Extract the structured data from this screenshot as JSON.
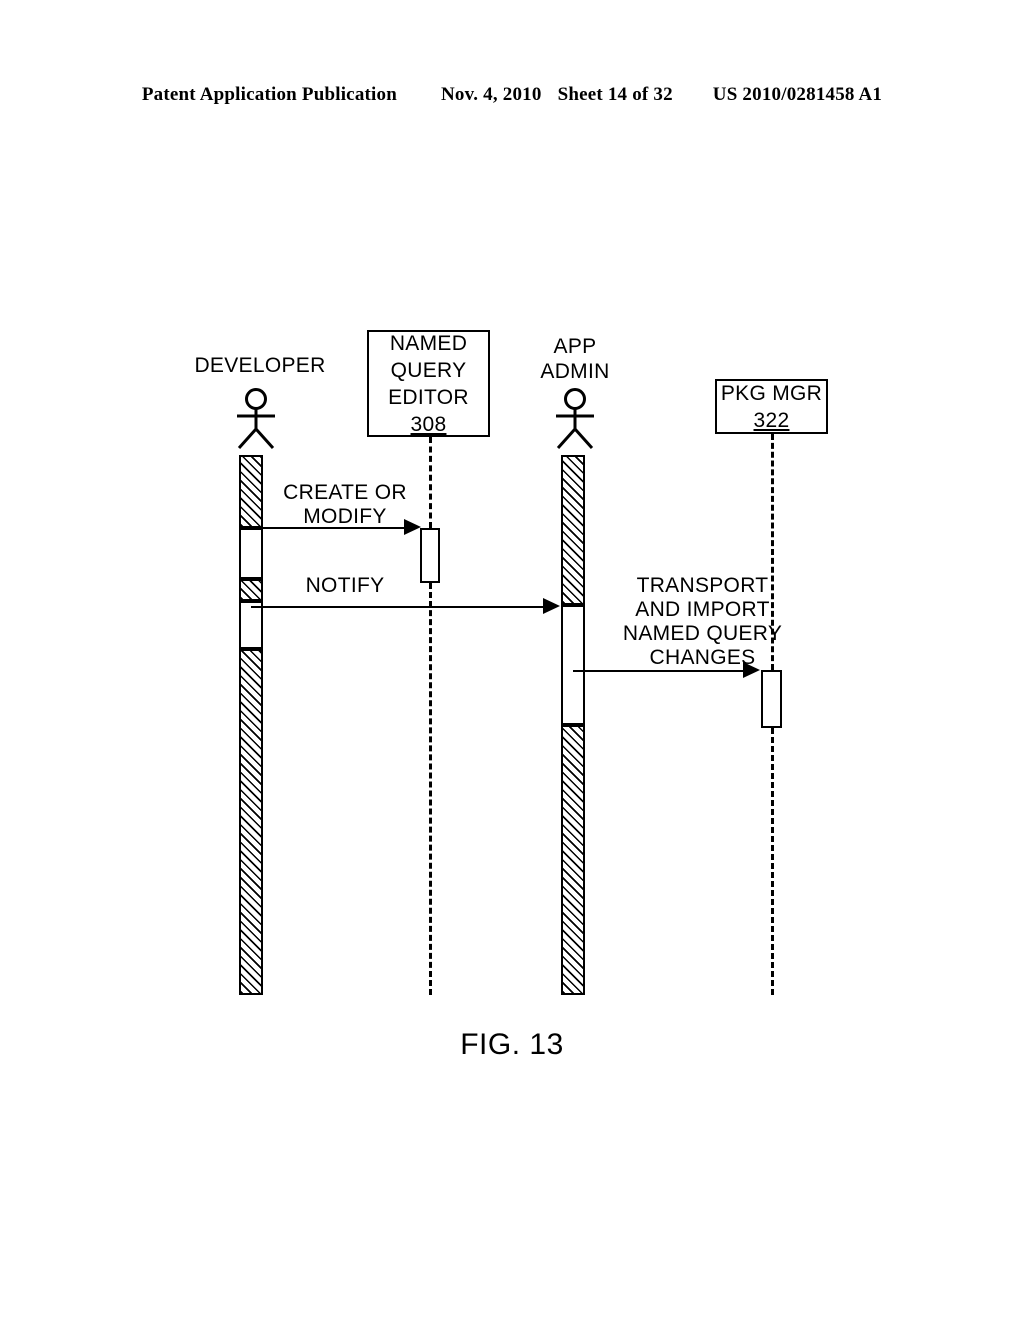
{
  "header": {
    "publication": "Patent Application Publication",
    "date": "Nov. 4, 2010",
    "sheet": "Sheet 14 of 32",
    "patent_number": "US 2010/0281458 A1"
  },
  "figure": {
    "caption": "FIG. 13",
    "type": "uml-sequence-diagram",
    "participants": [
      {
        "id": "developer",
        "kind": "actor",
        "label": "DEVELOPER",
        "ref": ""
      },
      {
        "id": "named-query-editor",
        "kind": "object",
        "label": "NAMED\nQUERY\nEDITOR",
        "ref": "308"
      },
      {
        "id": "app-admin",
        "kind": "actor",
        "label": "APP\nADMIN",
        "ref": ""
      },
      {
        "id": "pkg-mgr",
        "kind": "object",
        "label": "PKG MGR",
        "ref": "322"
      }
    ],
    "messages": [
      {
        "id": "create-or-modify",
        "label": "CREATE OR\nMODIFY",
        "from": "developer",
        "to": "named-query-editor"
      },
      {
        "id": "notify",
        "label": "NOTIFY",
        "from": "developer",
        "to": "app-admin"
      },
      {
        "id": "transport-and-import",
        "label": "TRANSPORT\nAND IMPORT\nNAMED QUERY\nCHANGES",
        "from": "app-admin",
        "to": "pkg-mgr"
      }
    ]
  }
}
